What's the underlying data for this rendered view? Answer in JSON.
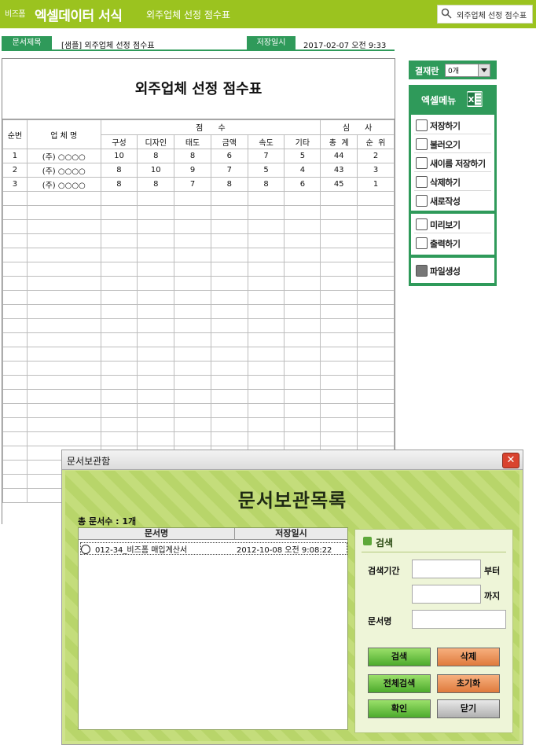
{
  "header": {
    "brand_small": "비즈폼",
    "brand_title": "엑셀데이터 서식",
    "subtitle": "외주업체 선정 점수표",
    "search_text": "외주업체 선정 점수표"
  },
  "doc_info": {
    "title_label": "문서제목",
    "title_value": "[샘플] 외주업체 선정 점수표",
    "saved_label": "저장일시",
    "saved_value": "2017-02-07  오전 9:33"
  },
  "sheet": {
    "title": "외주업체 선정 점수표",
    "headers": {
      "no": "순번",
      "company": "업 체 명",
      "score": "점      수",
      "review": "심      사",
      "score_cols": [
        "구성",
        "디자인",
        "태도",
        "금액",
        "속도",
        "기타"
      ],
      "review_cols": [
        "총  계",
        "순  위"
      ]
    },
    "rows": [
      {
        "no": "1",
        "company": "(주) ○○○○",
        "scores": [
          "10",
          "8",
          "8",
          "6",
          "7",
          "5"
        ],
        "total": "44",
        "rank": "2"
      },
      {
        "no": "2",
        "company": "(주) ○○○○",
        "scores": [
          "8",
          "10",
          "9",
          "7",
          "5",
          "4"
        ],
        "total": "43",
        "rank": "3"
      },
      {
        "no": "3",
        "company": "(주) ○○○○",
        "scores": [
          "8",
          "8",
          "7",
          "8",
          "8",
          "6"
        ],
        "total": "45",
        "rank": "1"
      }
    ]
  },
  "side": {
    "approval_label": "결재란",
    "approval_value": "0개",
    "menu_title": "엑셀메뉴",
    "menu_groups": [
      [
        {
          "icon": "save-icon",
          "label": "저장하기"
        },
        {
          "icon": "load-icon",
          "label": "불러오기"
        },
        {
          "icon": "save-as-icon",
          "label": "새이름 저장하기"
        },
        {
          "icon": "trash-icon",
          "label": "삭제하기"
        },
        {
          "icon": "new-doc-icon",
          "label": "새로작성"
        }
      ],
      [
        {
          "icon": "preview-icon",
          "label": "미리보기"
        },
        {
          "icon": "print-icon",
          "label": "출력하기"
        }
      ],
      [
        {
          "icon": "folder-icon",
          "label": "파일생성"
        }
      ]
    ]
  },
  "dialog": {
    "window_title": "문서보관함",
    "heading": "문서보관목록",
    "count_text": "총 문서수 : 1개",
    "list_headers": {
      "name": "문서명",
      "date": "저장일시"
    },
    "list_rows": [
      {
        "name": "012-34_비즈폼 매입계산서",
        "date": "2012-10-08 오전 9:08:22"
      }
    ],
    "search": {
      "title": "검색",
      "period_label": "검색기간",
      "from_suffix": "부터",
      "to_suffix": "까지",
      "name_label": "문서명",
      "from_value": "",
      "to_value": "",
      "name_value": ""
    },
    "buttons": {
      "search": "검색",
      "delete": "삭제",
      "search_all": "전체검색",
      "reset": "초기화",
      "ok": "확인",
      "close": "닫기"
    }
  }
}
